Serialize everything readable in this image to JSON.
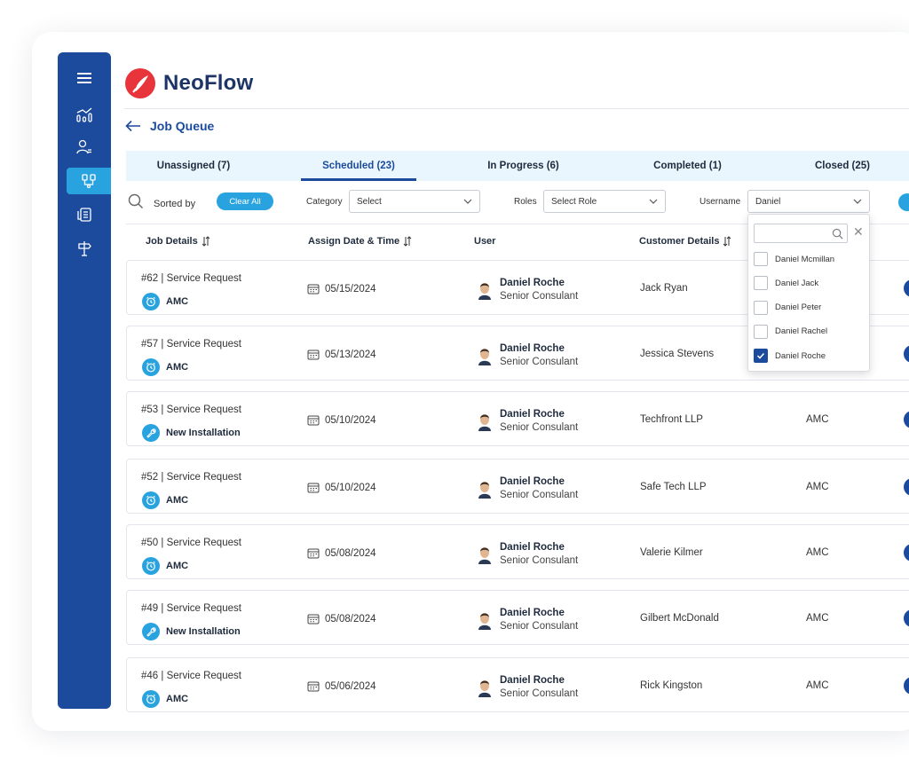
{
  "app": {
    "name": "NeoFlow"
  },
  "page": {
    "title": "Job Queue"
  },
  "tabs": [
    {
      "label": "Unassigned (7)"
    },
    {
      "label": "Scheduled (23)"
    },
    {
      "label": "In Progress (6)"
    },
    {
      "label": "Completed (1)"
    },
    {
      "label": "Closed (25)"
    }
  ],
  "active_tab": "Scheduled (23)",
  "filters": {
    "sorted_by_label": "Sorted by",
    "clear_all": "Clear All",
    "category_label": "Category",
    "category_value": "Select",
    "roles_label": "Roles",
    "roles_value": "Select Role",
    "username_label": "Username",
    "username_value": "Daniel"
  },
  "username_dropdown": {
    "search_placeholder": "",
    "options": [
      {
        "label": "Daniel Mcmillan",
        "checked": false
      },
      {
        "label": "Daniel Jack",
        "checked": false
      },
      {
        "label": "Daniel Peter",
        "checked": false
      },
      {
        "label": "Daniel Rachel",
        "checked": false
      },
      {
        "label": "Daniel Roche",
        "checked": true
      }
    ]
  },
  "table": {
    "headers": [
      "Job Details",
      "Assign Date & Time",
      "User",
      "Customer Details"
    ],
    "rows": [
      {
        "job": "#62  |  Service Request",
        "type": "AMC",
        "type_icon": "alarm-clock-icon",
        "date": "05/15/2024",
        "user_name": "Daniel Roche",
        "user_role": "Senior Consulant",
        "customer": "Jack Ryan",
        "service": ""
      },
      {
        "job": "#57  |  Service Request",
        "type": "AMC",
        "type_icon": "alarm-clock-icon",
        "date": "05/13/2024",
        "user_name": "Daniel Roche",
        "user_role": "Senior Consulant",
        "customer": "Jessica Stevens",
        "service": ""
      },
      {
        "job": "#53  |  Service Request",
        "type": "New Installation",
        "type_icon": "wrench-icon",
        "date": "05/10/2024",
        "user_name": "Daniel Roche",
        "user_role": "Senior Consulant",
        "customer": "Techfront LLP",
        "service": "AMC"
      },
      {
        "job": "#52  |  Service Request",
        "type": "AMC",
        "type_icon": "alarm-clock-icon",
        "date": "05/10/2024",
        "user_name": "Daniel Roche",
        "user_role": "Senior Consulant",
        "customer": "Safe Tech LLP",
        "service": "AMC"
      },
      {
        "job": "#50  |  Service Request",
        "type": "AMC",
        "type_icon": "alarm-clock-icon",
        "date": "05/08/2024",
        "user_name": "Daniel Roche",
        "user_role": "Senior Consulant",
        "customer": "Valerie Kilmer",
        "service": "AMC"
      },
      {
        "job": "#49  |  Service Request",
        "type": "New Installation",
        "type_icon": "wrench-icon",
        "date": "05/08/2024",
        "user_name": "Daniel Roche",
        "user_role": "Senior Consulant",
        "customer": "Gilbert McDonald",
        "service": "AMC"
      },
      {
        "job": "#46  |  Service Request",
        "type": "AMC",
        "type_icon": "alarm-clock-icon",
        "date": "05/06/2024",
        "user_name": "Daniel Roche",
        "user_role": "Senior Consulant",
        "customer": "Rick Kingston",
        "service": "AMC"
      }
    ]
  },
  "sidebar": {
    "items": [
      {
        "icon": "menu-icon"
      },
      {
        "icon": "analytics-icon"
      },
      {
        "icon": "user-list-icon"
      },
      {
        "icon": "job-queue-icon"
      },
      {
        "icon": "document-list-icon"
      },
      {
        "icon": "signpost-icon"
      }
    ]
  },
  "colors": {
    "primary": "#1c4a9c",
    "accent": "#29a3e0",
    "logo": "#e8353b"
  }
}
